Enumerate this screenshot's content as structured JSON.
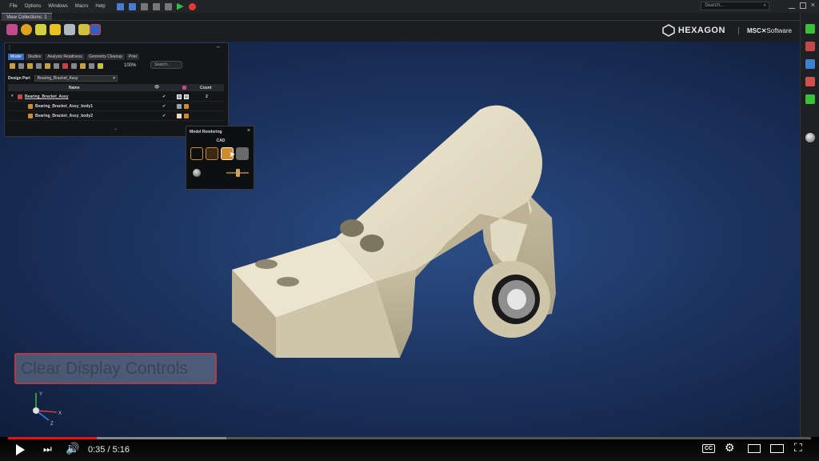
{
  "menu": [
    "File",
    "Options",
    "Windows",
    "Macro",
    "Help"
  ],
  "search_placeholder": "Search...",
  "tab_view": "View Collections: 1",
  "brand": {
    "hexagon": "HEXAGON",
    "msc": "MSC",
    "software": "Software"
  },
  "browser": {
    "tabs": [
      "Model",
      "Studies",
      "Analysis Readiness",
      "Geometry Cleanup",
      "Post"
    ],
    "zoom": "100%",
    "search_placeholder": "Search...",
    "design_part_label": "Design Part",
    "design_part_value": "Bearing_Bracket_Assy",
    "columns": {
      "name": "Name",
      "count": "Count"
    },
    "rows": [
      {
        "name": "Bearing_Bracket_Assy",
        "count": "2",
        "box_color": "#9aa0a8"
      },
      {
        "name": "Bearing_Bracket_Assy_body1",
        "count": "",
        "box_color": "#9aa0a8"
      },
      {
        "name": "Bearing_Bracket_Assy_body2",
        "count": "",
        "box_color": "#e8dcc0"
      }
    ]
  },
  "render_popup": {
    "title": "Model Rendering",
    "subtitle": "CAD"
  },
  "caption": "Clear Display Controls",
  "axes": {
    "x": "X",
    "y": "Y",
    "z": "Z"
  },
  "video": {
    "time": "0:35 / 5:16",
    "progress": 0.111,
    "buffered": 0.272,
    "cc": "CC"
  },
  "colors": {
    "accent": "#3a6cc4",
    "model": "#e3dac4",
    "progress": "#ee1111"
  }
}
